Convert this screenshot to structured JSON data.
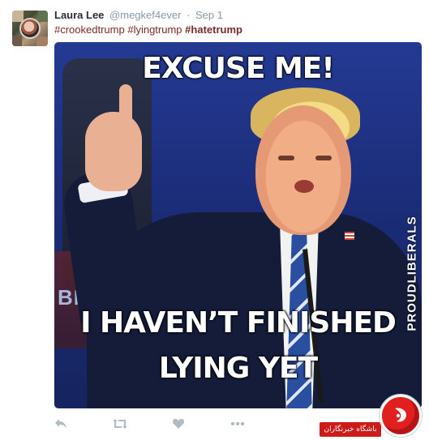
{
  "tweet": {
    "author_name": "Laura Lee",
    "author_handle": "@megkef4ever",
    "separator": "·",
    "date": "Sep 1",
    "hashtags": [
      "#crookedtrump",
      "#lyingtrump",
      "#hatetrump"
    ]
  },
  "media": {
    "caption_top": "EXCUSE ME!",
    "caption_bottom_line1": "I HAVEN’T FINISHED",
    "caption_bottom_line2": "LYING YET",
    "watermark": "PROUDLIBERALS",
    "background_text": "BRA"
  },
  "actions": {
    "icons": [
      "reply-icon",
      "retweet-icon",
      "like-icon",
      "more-icon"
    ]
  },
  "overlay": {
    "badge_text": "باشگاه خبرنگاران"
  },
  "colors": {
    "hashtag": "#7a2a2a",
    "muted": "#8899a6",
    "action_icon": "#b1bbc3",
    "badge": "#cf1a1a"
  }
}
